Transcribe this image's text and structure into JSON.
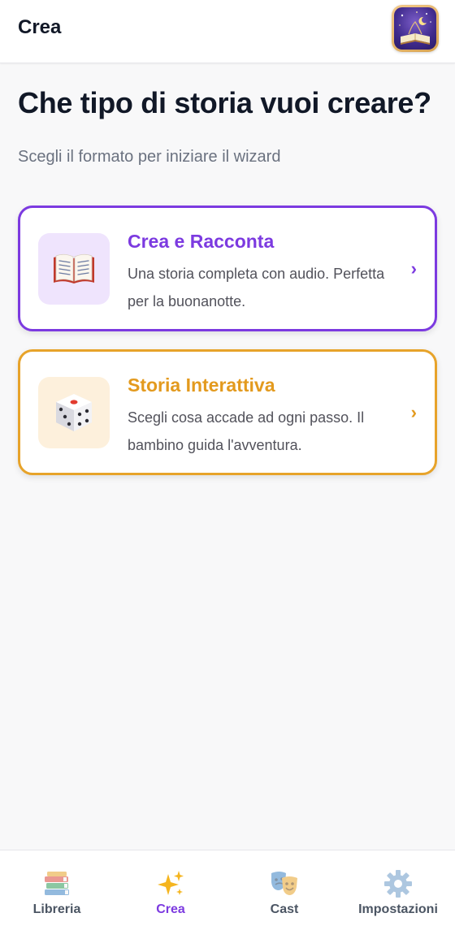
{
  "header": {
    "title": "Crea",
    "logo_icon": "app-logo-storybook"
  },
  "main": {
    "title": "Che tipo di storia vuoi creare?",
    "subtitle": "Scegli il formato per iniziare il wizard",
    "options": [
      {
        "icon": "open-book-icon",
        "title": "Crea e Racconta",
        "description": "Una storia completa con audio. Perfetta per la buonanotte.",
        "accent": "#7c3ae0"
      },
      {
        "icon": "dice-icon",
        "title": "Storia Interattiva",
        "description": "Scegli cosa accade ad ogni passo. Il bambino guida l'avventura.",
        "accent": "#e39a1e"
      }
    ],
    "chevron": "›"
  },
  "bottom_nav": {
    "items": [
      {
        "label": "Libreria",
        "icon": "books-icon",
        "active": false
      },
      {
        "label": "Crea",
        "icon": "sparkles-icon",
        "active": true
      },
      {
        "label": "Cast",
        "icon": "theater-masks-icon",
        "active": false
      },
      {
        "label": "Impostazioni",
        "icon": "gear-icon",
        "active": false
      }
    ]
  },
  "colors": {
    "accent_purple": "#7c3ae0",
    "accent_orange": "#e39a1e",
    "background": "#f8f8f9"
  }
}
